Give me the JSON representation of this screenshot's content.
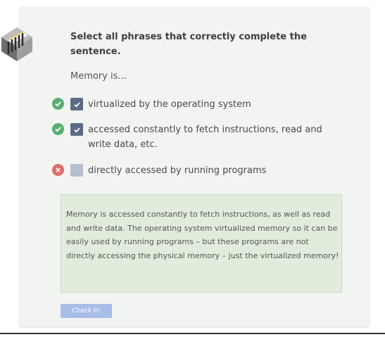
{
  "question": {
    "prompt": "Select all phrases that correctly complete the sentence.",
    "stem": "Memory is..."
  },
  "options": [
    {
      "label": "virtualized by the operating system",
      "checked": true,
      "result": "correct"
    },
    {
      "label": "accessed constantly to fetch instructions, read and write data, etc.",
      "checked": true,
      "result": "correct"
    },
    {
      "label": "directly accessed by running programs",
      "checked": false,
      "result": "wrong"
    }
  ],
  "feedback": {
    "text": "Memory is accessed constantly to fetch instructions, as well as read and write data. The operating system virtualized memory so it can be easily used by running programs – but these programs are not directly accessing the physical memory – just the virtualized memory!"
  },
  "actions": {
    "check_label": "Check It!"
  },
  "colors": {
    "card_bg": "#f1f4f0",
    "correct": "#5aae72",
    "wrong": "#e06c6c",
    "checkbox_checked": "#5d6b86",
    "checkbox_unchecked": "#b7bed0",
    "feedback_bg": "#e1ecdc",
    "button": "#a8bde8"
  },
  "icons": {
    "illustration": "memory-chip-icon",
    "correct": "check-circle-icon",
    "wrong": "x-circle-icon",
    "checkmark": "checkmark-icon"
  }
}
